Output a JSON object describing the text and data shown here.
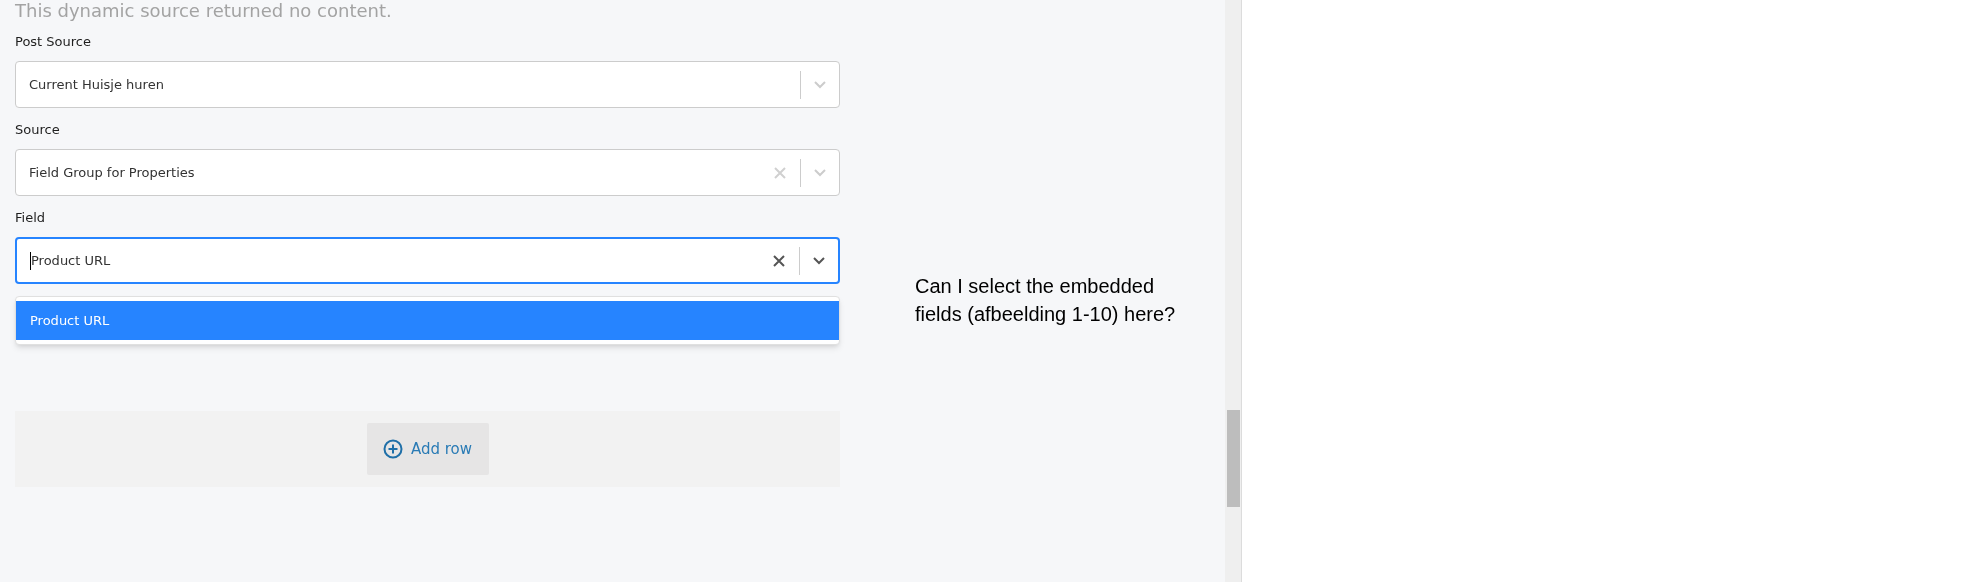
{
  "notice": "This dynamic source returned no content.",
  "fields": [
    {
      "label": "Post Source",
      "value": "Current Huisje huren",
      "clearable": false,
      "focused": false
    },
    {
      "label": "Source",
      "value": "Field Group for Properties",
      "clearable": true,
      "focused": false
    },
    {
      "label": "Field",
      "value": "Product URL",
      "clearable": true,
      "focused": true
    }
  ],
  "dropdown": {
    "options": [
      {
        "label": "Product URL",
        "selected": true
      }
    ]
  },
  "add_row_button": "Add row",
  "comment": "Can I select the embedded fields (afbeelding 1-10) here?"
}
